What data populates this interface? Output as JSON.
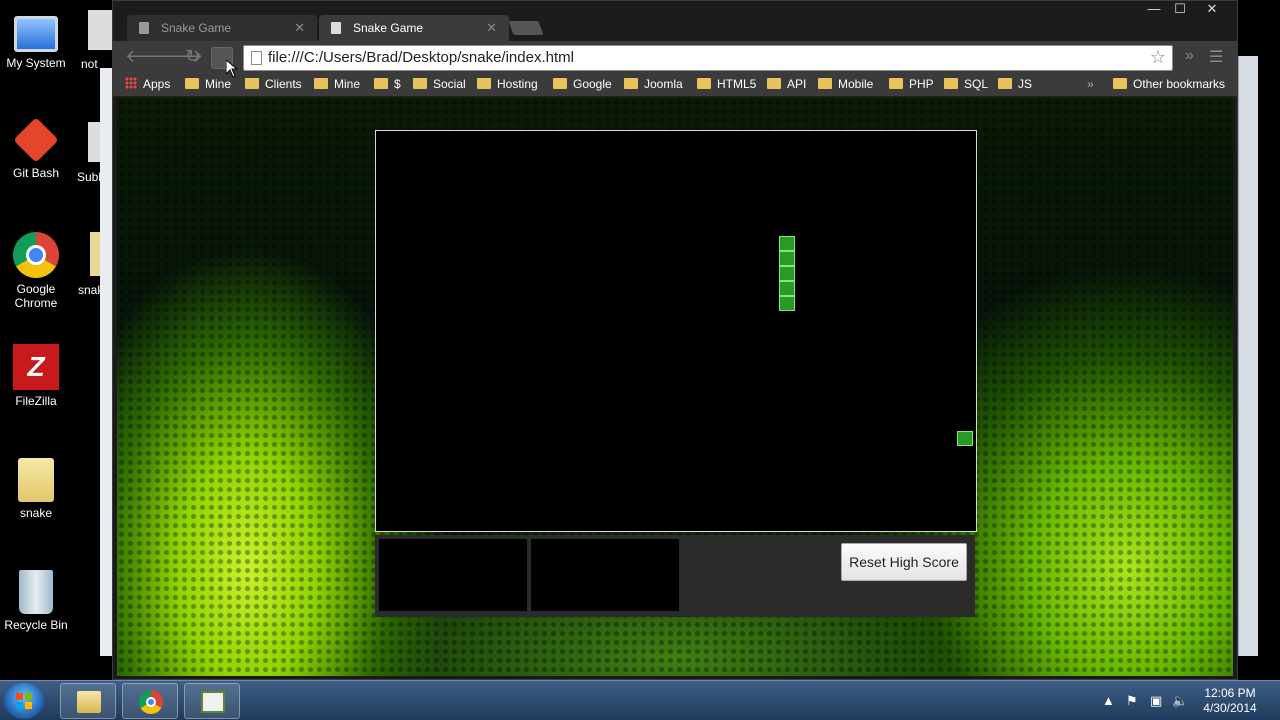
{
  "desktop": {
    "icons": [
      {
        "label": "My System",
        "icon": "computer-icon"
      },
      {
        "label": "Git Bash",
        "icon": "git-bash-icon"
      },
      {
        "label": "Google Chrome",
        "icon": "chrome-icon"
      },
      {
        "label": "FileZilla",
        "icon": "filezilla-icon"
      },
      {
        "label": "snake",
        "icon": "folder-icon"
      },
      {
        "label": "Recycle Bin",
        "icon": "recycle-bin-icon"
      }
    ],
    "partial_labels": [
      "not",
      "Subl",
      "snak"
    ]
  },
  "browser": {
    "tabs": [
      {
        "title": "Snake Game",
        "active": false
      },
      {
        "title": "Snake Game",
        "active": true
      }
    ],
    "url": "file:///C:/Users/Brad/Desktop/snake/index.html",
    "bookmarks": [
      "Apps",
      "Mine",
      "Clients",
      "Mine",
      "$",
      "Social",
      "Hosting",
      "Google",
      "Joomla",
      "HTML5",
      "API",
      "Mobile",
      "PHP",
      "SQL",
      "JS"
    ],
    "bookmarks_overflow": "»",
    "other_bookmarks": "Other bookmarks",
    "window_controls": {
      "minimize": "—",
      "maximize": "☐",
      "close": "✕"
    }
  },
  "game": {
    "snake_color": "#2a9a26",
    "snake_segments": [
      [
        25,
        7
      ],
      [
        25,
        8
      ],
      [
        25,
        9
      ],
      [
        25,
        10
      ],
      [
        25,
        11
      ]
    ],
    "food": [
      39,
      20
    ],
    "grid_cell": 15,
    "reset_label": "Reset High Score"
  },
  "taskbar": {
    "apps": [
      "explorer-icon",
      "chrome-icon",
      "editor-icon"
    ],
    "time": "12:06 PM",
    "date": "4/30/2014"
  }
}
